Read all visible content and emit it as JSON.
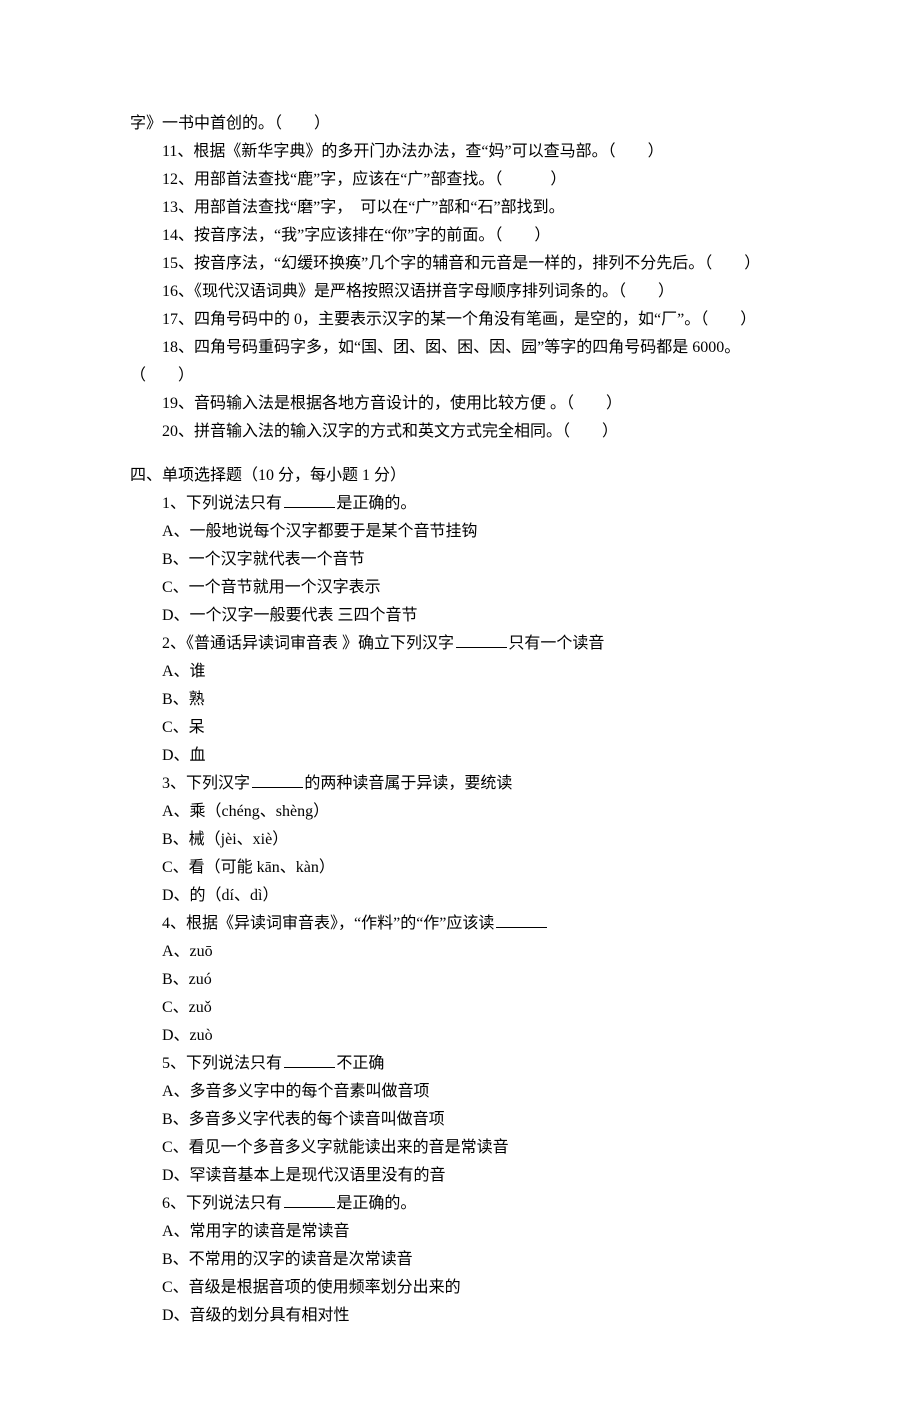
{
  "continuation": "字》一书中首创的。（　　）",
  "tfq": [
    "11、根据《新华字典》的多开门办法办法，查“妈”可以查马部。（　　）",
    "12、用部首法查找“鹿”字，应该在“广”部查找。（　　　）",
    "13、用部首法查找“磨”字，　可以在“广”部和“石”部找到。",
    "14、按音序法，“我”字应该排在“你”字的前面。（　　）",
    "15、按音序法，“幻缓环换痪”几个字的辅音和元音是一样的，排列不分先后。（　　）",
    "16、《现代汉语词典》是严格按照汉语拼音字母顺序排列词条的。（　　）",
    "17、四角号码中的 0，主要表示汉字的某一个角没有笔画，是空的，如“厂”。（　　）",
    "18、四角号码重码字多，如“国、团、囡、困、因、园”等字的四角号码都是 6000。"
  ],
  "tfq18_tail": "（　　）",
  "tfq_rest": [
    "19、音码输入法是根据各地方音设计的，使用比较方便 。（　　）",
    "20、拼音输入法的输入汉字的方式和英文方式完全相同。（　　）"
  ],
  "section4": "四、单项选择题（10 分，每小题 1 分）",
  "mcq": [
    {
      "stem_pre": "1、下列说法只有",
      "stem_post": "是正确的。",
      "opts": [
        "A、一般地说每个汉字都要于是某个音节挂钩",
        "B、一个汉字就代表一个音节",
        "C、一个音节就用一个汉字表示",
        "D、一个汉字一般要代表 三四个音节"
      ]
    },
    {
      "stem_pre": "2、《普通话异读词审音表 》确立下列汉字",
      "stem_post": "只有一个读音",
      "opts": [
        "A、谁",
        "B、熟",
        "C、呆",
        "D、血"
      ]
    },
    {
      "stem_pre": "3、下列汉字",
      "stem_post": "的两种读音属于异读，要统读",
      "opts": [
        "A、乘（chéng、shèng）",
        "B、械（jèi、xiè）",
        "C、看（可能 kān、kàn）",
        "D、的（dí、dì）"
      ]
    },
    {
      "stem_pre": "4、根据《异读词审音表》，“作料”的“作”应该读",
      "stem_post": "",
      "opts": [
        "A、zuō",
        "B、zuó",
        "C、zuǒ",
        "D、zuò"
      ]
    },
    {
      "stem_pre": "5、下列说法只有",
      "stem_post": "不正确",
      "opts": [
        "A、多音多义字中的每个音素叫做音项",
        "B、多音多义字代表的每个读音叫做音项",
        "C、看见一个多音多义字就能读出来的音是常读音",
        "D、罕读音基本上是现代汉语里没有的音"
      ]
    },
    {
      "stem_pre": "6、下列说法只有",
      "stem_post": "是正确的。",
      "opts": [
        "A、常用字的读音是常读音",
        "B、不常用的汉字的读音是次常读音",
        "C、音级是根据音项的使用频率划分出来的",
        "D、音级的划分具有相对性"
      ]
    }
  ]
}
